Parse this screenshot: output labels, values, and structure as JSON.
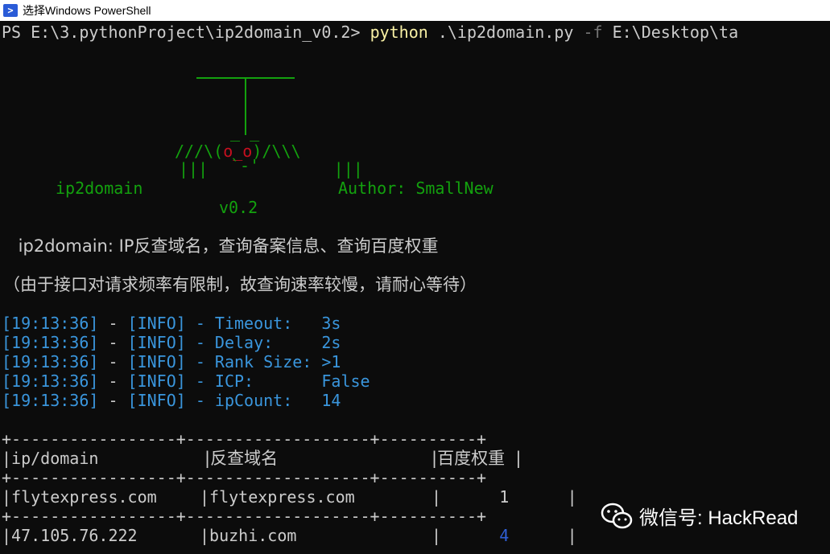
{
  "window": {
    "title": "选择Windows PowerShell",
    "icon": "powershell-icon"
  },
  "prompt": {
    "path": "PS E:\\3.pythonProject\\ip2domain_v0.2> ",
    "command": "python",
    "arg1": " .\\ip2domain.py ",
    "flag": "-f",
    "arg2": " E:\\Desktop\\ta"
  },
  "banner": {
    "art_legs": "///\\(",
    "art_eyes": "o_o",
    "art_legs2": ")/\\\\\\",
    "art_row2": "|||             |||",
    "art_face_top": "_ _",
    "art_mouth": "`-'",
    "name": "ip2domain",
    "author": "Author: SmallNew",
    "version": "v0.2"
  },
  "description": " ip2domain: IP反查域名，查询备案信息、查询百度权重",
  "note": "（由于接口对请求频率有限制，故查询速率较慢，请耐心等待）",
  "log": [
    {
      "time": "[19:13:36]",
      "sep": " - ",
      "level": "[INFO]",
      "dash": " - ",
      "key": "Timeout:   ",
      "value": "3s"
    },
    {
      "time": "[19:13:36]",
      "sep": " - ",
      "level": "[INFO]",
      "dash": " - ",
      "key": "Delay:     ",
      "value": "2s"
    },
    {
      "time": "[19:13:36]",
      "sep": " - ",
      "level": "[INFO]",
      "dash": " - ",
      "key": "Rank Size: ",
      "value": ">1"
    },
    {
      "time": "[19:13:36]",
      "sep": " - ",
      "level": "[INFO]",
      "dash": " - ",
      "key": "ICP:       ",
      "value": "False"
    },
    {
      "time": "[19:13:36]",
      "sep": " - ",
      "level": "[INFO]",
      "dash": " - ",
      "key": "ipCount:   ",
      "value": "14"
    }
  ],
  "table": {
    "border": "+-----------------+-------------------+----------+",
    "headers": [
      "ip/domain",
      "反查域名",
      "百度权重"
    ],
    "rows": [
      {
        "ip": "flytexpress.com",
        "domain": "flytexpress.com",
        "rank": "1"
      },
      {
        "ip": "47.105.76.222",
        "domain": "buzhi.com",
        "rank": "4"
      }
    ]
  },
  "watermark": {
    "text": "微信号: HackRead",
    "icon": "wechat-icon"
  }
}
